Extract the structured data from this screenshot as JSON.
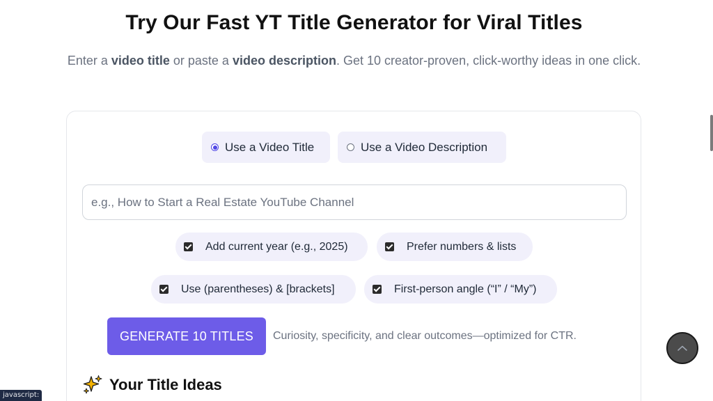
{
  "hero": {
    "title": "Try Our Fast YT Title Generator for Viral Titles",
    "subtitle_parts": {
      "p1": "Enter a ",
      "b1": "video title",
      "p2": " or paste a ",
      "b2": "video description",
      "p3": ". Get 10 creator-proven, click-worthy ideas in one click."
    }
  },
  "mode": {
    "options": [
      {
        "label": "Use a Video Title",
        "selected": true
      },
      {
        "label": "Use a Video Description",
        "selected": false
      }
    ]
  },
  "input": {
    "placeholder": "e.g., How to Start a Real Estate YouTube Channel",
    "value": ""
  },
  "options": [
    {
      "label": "Add current year (e.g., 2025)",
      "checked": true
    },
    {
      "label": "Prefer numbers & lists",
      "checked": true
    },
    {
      "label": "Use (parentheses) & [brackets]",
      "checked": true
    },
    {
      "label": "First-person angle (“I” / “My”)",
      "checked": true
    }
  ],
  "actions": {
    "generate_label": "GENERATE 10 TITLES",
    "helper": "Curiosity, specificity, and clear outcomes—optimized for CTR."
  },
  "results": {
    "heading": "Your Title Ideas",
    "icon": "sparkles-icon"
  },
  "status_bar": {
    "text": "javascript:"
  },
  "colors": {
    "accent": "#6d5ce8",
    "pill_bg": "#f1f0fb",
    "text_muted": "#6b7280"
  }
}
